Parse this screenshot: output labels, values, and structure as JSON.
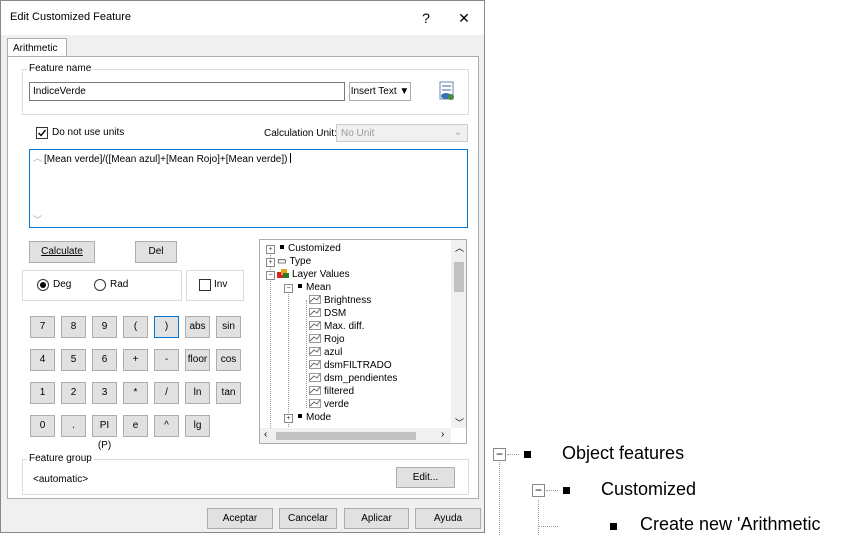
{
  "dialog": {
    "title": "Edit Customized Feature",
    "help_label": "?",
    "close_label": "✕",
    "tab_label": "Arithmetic"
  },
  "feature_name": {
    "legend": "Feature name",
    "value": "IndiceVerde",
    "insert_text_label": "Insert Text ▼"
  },
  "units": {
    "checkbox_label": "Do not use units",
    "checked": true,
    "calc_unit_label": "Calculation Unit:",
    "calc_unit_value": "No Unit"
  },
  "expression": {
    "value": "[Mean verde]/([Mean azul]+[Mean Rojo]+[Mean verde])"
  },
  "calculator": {
    "calculate_label": "Calculate",
    "del_label": "Del",
    "deg_label": "Deg",
    "rad_label": "Rad",
    "inv_label": "Inv",
    "angle_mode": "Deg",
    "keys": [
      [
        "7",
        "8",
        "9",
        "(",
        ")",
        "abs",
        "sin"
      ],
      [
        "4",
        "5",
        "6",
        "+",
        "-",
        "floor",
        "cos"
      ],
      [
        "1",
        "2",
        "3",
        "*",
        "/",
        "ln",
        "tan"
      ],
      [
        "0",
        ".",
        "PI (P)",
        "e",
        "^",
        "lg"
      ]
    ]
  },
  "tree": {
    "customized": "Customized",
    "type": "Type",
    "layer_values": "Layer Values",
    "mean": "Mean",
    "mean_items": [
      "Brightness",
      "DSM",
      "Max. diff.",
      "Rojo",
      "azul",
      "dsmFILTRADO",
      "dsm_pendientes",
      "filtered",
      "verde"
    ],
    "mode": "Mode"
  },
  "feature_group": {
    "legend": "Feature group",
    "value": "<automatic>",
    "edit_label": "Edit..."
  },
  "footer": {
    "ok_label": "Aceptar",
    "cancel_label": "Cancelar",
    "apply_label": "Aplicar",
    "help_label": "Ayuda"
  },
  "side_tree": {
    "object_features": "Object features",
    "customized": "Customized",
    "create_new": "Create new 'Arithmetic"
  }
}
